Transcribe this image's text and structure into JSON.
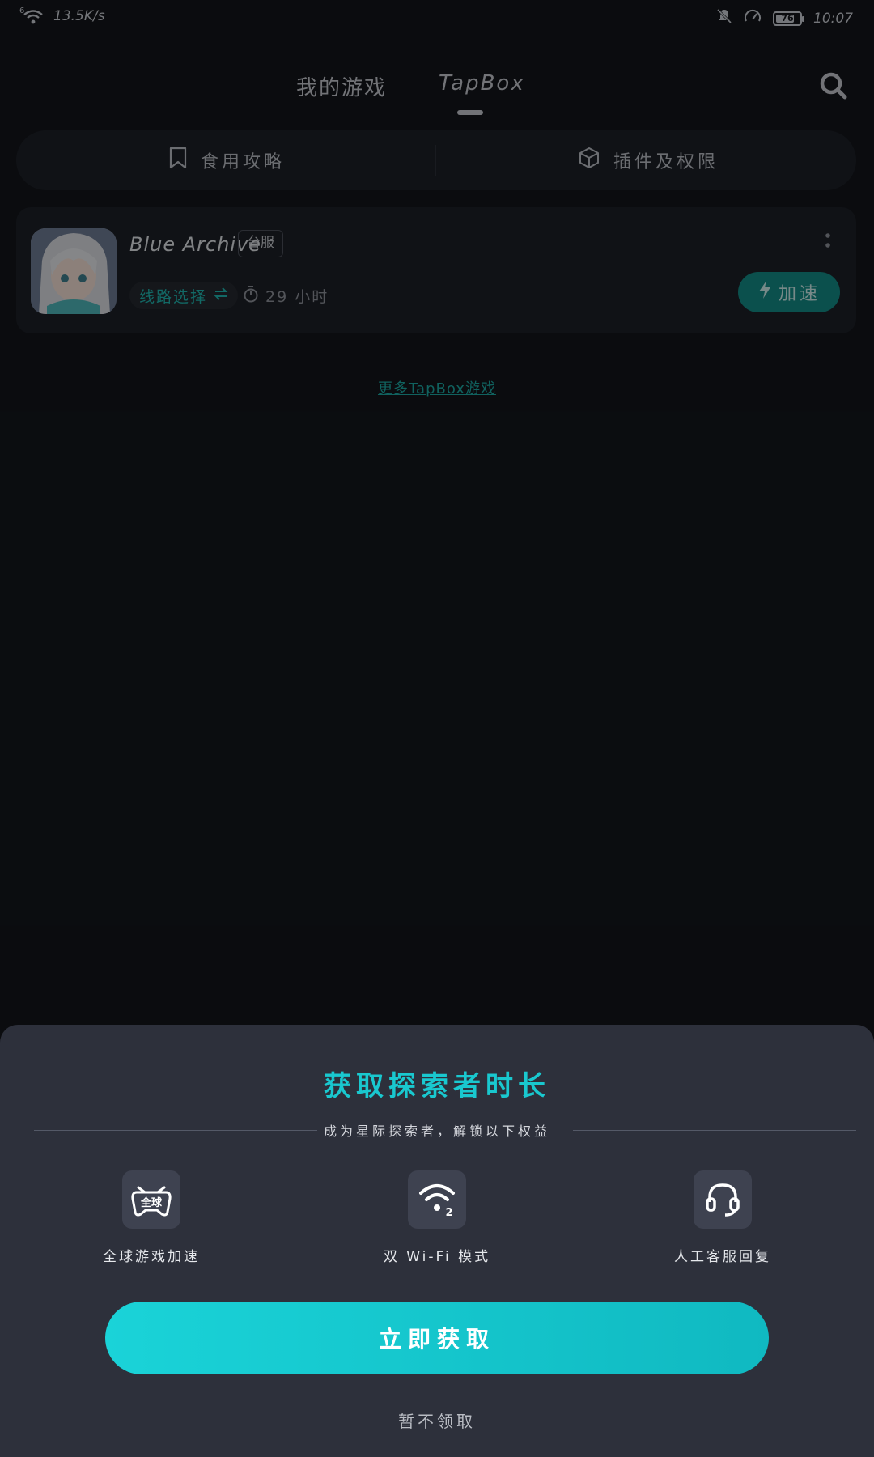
{
  "status_bar": {
    "network_type": "6",
    "speed": "13.5K/s",
    "battery": "76",
    "time": "10:07"
  },
  "header": {
    "tabs": [
      {
        "label": "我的游戏"
      },
      {
        "label": "TapBox"
      }
    ],
    "active_tab": "TapBox"
  },
  "guide_bar": {
    "guide_label": "食用攻略",
    "plugins_label": "插件及权限"
  },
  "game_card": {
    "title": "Blue Archive",
    "region": "台服",
    "route_label": "线路选择",
    "hours": "29 小时",
    "accelerate_label": "加速"
  },
  "more_games_link": "更多TapBox游戏",
  "sheet": {
    "title": "获取探索者时长",
    "subtitle": "成为星际探索者，解锁以下权益",
    "benefits": [
      {
        "icon": "gamepad-global-icon",
        "icon_text": "全球",
        "label": "全球游戏加速"
      },
      {
        "icon": "wifi-dual-icon",
        "icon_text": "2",
        "label": "双 Wi-Fi 模式"
      },
      {
        "icon": "headset-icon",
        "label": "人工客服回复"
      }
    ],
    "claim_button": "立即获取",
    "dismiss_label": "暂不领取"
  },
  "colors": {
    "accent": "#19c8cf",
    "accent_button": "#12c2ca",
    "sheet_bg": "#2d303b",
    "page_bg": "#13161b"
  }
}
